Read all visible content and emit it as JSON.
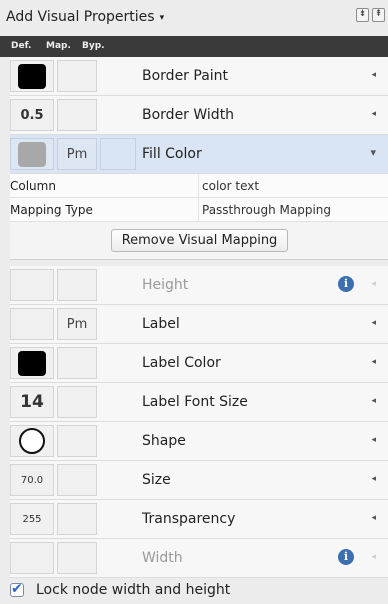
{
  "toolbar": {
    "add_label": "Add Visual Properties",
    "caret": "▾",
    "icon_collapse": "⇟",
    "icon_expand": "⇞"
  },
  "columns": {
    "def": "Def.",
    "map": "Map.",
    "byp": "Byp."
  },
  "rows": [
    {
      "def_type": "swatch",
      "def_color": "#000000",
      "map": "",
      "name": "Border Paint",
      "arrow": "◂",
      "disabled": false
    },
    {
      "def_type": "text",
      "def_text": "0.5",
      "map": "",
      "name": "Border Width",
      "arrow": "◂",
      "disabled": false
    },
    {
      "def_type": "swatch",
      "def_color": "#a8a8a8",
      "map": "Pm",
      "name": "Fill Color",
      "arrow": "▾",
      "disabled": false,
      "selected": true
    }
  ],
  "mapping": {
    "column_key": "Column",
    "column_value": "color text",
    "type_key": "Mapping Type",
    "type_value": "Passthrough Mapping",
    "remove_label": "Remove Visual Mapping"
  },
  "rows2": [
    {
      "def_type": "none",
      "map": "",
      "name": "Height",
      "arrow": "◂",
      "disabled": true,
      "info": true
    },
    {
      "def_type": "none",
      "map": "Pm",
      "name": "Label",
      "arrow": "◂",
      "disabled": false
    },
    {
      "def_type": "swatch",
      "def_color": "#000000",
      "map": "",
      "name": "Label Color",
      "arrow": "◂",
      "disabled": false
    },
    {
      "def_type": "text",
      "def_text": "14",
      "def_size": "large",
      "map": "",
      "name": "Label Font Size",
      "arrow": "◂",
      "disabled": false
    },
    {
      "def_type": "circle",
      "map": "",
      "name": "Shape",
      "arrow": "◂",
      "disabled": false
    },
    {
      "def_type": "text",
      "def_text": "70.0",
      "def_size": "small",
      "map": "",
      "name": "Size",
      "arrow": "◂",
      "disabled": false
    },
    {
      "def_type": "text",
      "def_text": "255",
      "def_size": "small",
      "map": "",
      "name": "Transparency",
      "arrow": "◂",
      "disabled": false
    },
    {
      "def_type": "none",
      "map": "",
      "name": "Width",
      "arrow": "◂",
      "disabled": true,
      "info": true
    }
  ],
  "info_glyph": "i",
  "lock": {
    "label": "Lock node width and height",
    "checked": true
  }
}
